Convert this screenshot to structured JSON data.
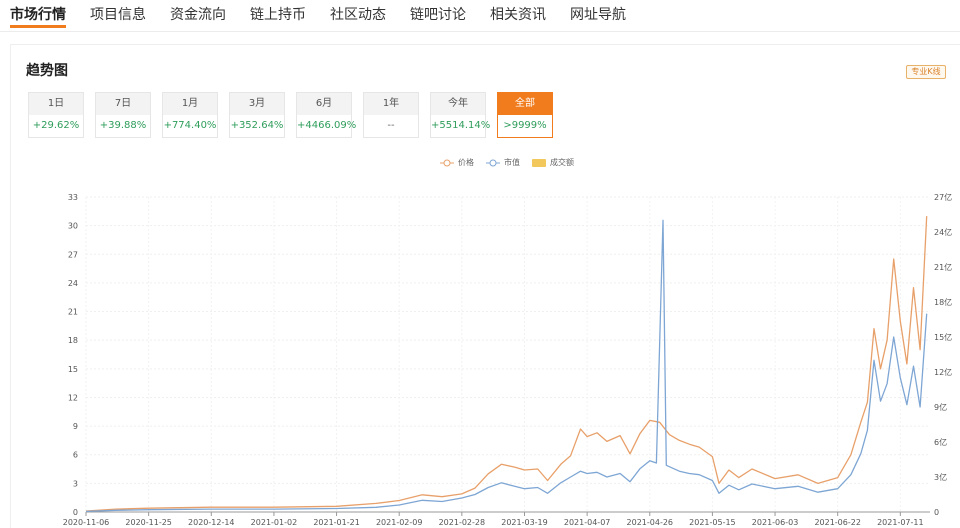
{
  "nav": {
    "items": [
      "市场行情",
      "项目信息",
      "资金流向",
      "链上持币",
      "社区动态",
      "链吧讨论",
      "相关资讯",
      "网址导航"
    ],
    "active_index": 0
  },
  "section": {
    "title": "趋势图",
    "pro_button": "专业K线"
  },
  "periods": [
    {
      "label": "1日",
      "change": "+29.62%"
    },
    {
      "label": "7日",
      "change": "+39.88%"
    },
    {
      "label": "1月",
      "change": "+774.40%"
    },
    {
      "label": "3月",
      "change": "+352.64%"
    },
    {
      "label": "6月",
      "change": "+4466.09%"
    },
    {
      "label": "1年",
      "change": "--"
    },
    {
      "label": "今年",
      "change": "+5514.14%"
    },
    {
      "label": "全部",
      "change": ">9999%",
      "active": true
    }
  ],
  "colors": {
    "accent": "#f07c1e",
    "price": "#e8a06a",
    "market_cap": "#7ea6d4",
    "volume": "#f2c75c",
    "positive": "#2f9d5b"
  },
  "chart_data": {
    "type": "line",
    "legend": [
      {
        "name": "价格",
        "color": "#e8a06a",
        "symbol": "circle"
      },
      {
        "name": "市值",
        "color": "#7ea6d4",
        "symbol": "circle"
      },
      {
        "name": "成交额",
        "color": "#f2c75c",
        "symbol": "rect"
      }
    ],
    "x_ticks": [
      "2020-11-06",
      "2020-11-25",
      "2020-12-14",
      "2021-01-02",
      "2021-01-21",
      "2021-02-09",
      "2021-02-28",
      "2021-03-19",
      "2021-04-07",
      "2021-04-26",
      "2021-05-15",
      "2021-06-03",
      "2021-06-22",
      "2021-07-11"
    ],
    "y_left_ticks": [
      "0",
      "3",
      "6",
      "9",
      "12",
      "15",
      "18",
      "21",
      "24",
      "27",
      "30",
      "33"
    ],
    "y_right_ticks": [
      "0",
      "3亿",
      "6亿",
      "9亿",
      "12亿",
      "15亿",
      "18亿",
      "21亿",
      "24亿",
      "27亿"
    ],
    "y_left_range": [
      0,
      33
    ],
    "y_right_range": [
      0,
      27
    ],
    "x_range": [
      "2020-11-06",
      "2021-07-20"
    ],
    "grid": true,
    "legend_position": "top-center",
    "series": [
      {
        "name": "价格",
        "axis": "left",
        "points": [
          [
            "2020-11-06",
            0.1
          ],
          [
            "2020-11-15",
            0.3
          ],
          [
            "2020-11-25",
            0.4
          ],
          [
            "2020-12-14",
            0.5
          ],
          [
            "2021-01-02",
            0.5
          ],
          [
            "2021-01-21",
            0.6
          ],
          [
            "2021-02-02",
            0.9
          ],
          [
            "2021-02-09",
            1.2
          ],
          [
            "2021-02-16",
            1.8
          ],
          [
            "2021-02-22",
            1.6
          ],
          [
            "2021-02-28",
            1.9
          ],
          [
            "2021-03-04",
            2.5
          ],
          [
            "2021-03-08",
            4.0
          ],
          [
            "2021-03-12",
            5.0
          ],
          [
            "2021-03-16",
            4.7
          ],
          [
            "2021-03-19",
            4.4
          ],
          [
            "2021-03-23",
            4.5
          ],
          [
            "2021-03-26",
            3.3
          ],
          [
            "2021-03-30",
            5.0
          ],
          [
            "2021-04-02",
            5.9
          ],
          [
            "2021-04-05",
            8.7
          ],
          [
            "2021-04-07",
            7.9
          ],
          [
            "2021-04-10",
            8.3
          ],
          [
            "2021-04-13",
            7.4
          ],
          [
            "2021-04-17",
            8.0
          ],
          [
            "2021-04-20",
            6.1
          ],
          [
            "2021-04-23",
            8.2
          ],
          [
            "2021-04-26",
            9.6
          ],
          [
            "2021-04-29",
            9.4
          ],
          [
            "2021-05-02",
            8.1
          ],
          [
            "2021-05-05",
            7.5
          ],
          [
            "2021-05-08",
            7.1
          ],
          [
            "2021-05-11",
            6.8
          ],
          [
            "2021-05-15",
            5.8
          ],
          [
            "2021-05-17",
            3.0
          ],
          [
            "2021-05-20",
            4.4
          ],
          [
            "2021-05-23",
            3.6
          ],
          [
            "2021-05-27",
            4.5
          ],
          [
            "2021-06-03",
            3.5
          ],
          [
            "2021-06-10",
            3.9
          ],
          [
            "2021-06-16",
            3.0
          ],
          [
            "2021-06-22",
            3.6
          ],
          [
            "2021-06-26",
            6.0
          ],
          [
            "2021-06-29",
            9.4
          ],
          [
            "2021-07-01",
            11.5
          ],
          [
            "2021-07-03",
            19.2
          ],
          [
            "2021-07-05",
            15.0
          ],
          [
            "2021-07-07",
            18.0
          ],
          [
            "2021-07-09",
            26.5
          ],
          [
            "2021-07-11",
            20.0
          ],
          [
            "2021-07-13",
            15.5
          ],
          [
            "2021-07-15",
            23.5
          ],
          [
            "2021-07-17",
            17.0
          ],
          [
            "2021-07-19",
            31.0
          ]
        ]
      },
      {
        "name": "市值",
        "axis": "right",
        "points": [
          [
            "2020-11-06",
            0.05
          ],
          [
            "2020-11-15",
            0.15
          ],
          [
            "2020-11-25",
            0.2
          ],
          [
            "2020-12-14",
            0.25
          ],
          [
            "2021-01-02",
            0.25
          ],
          [
            "2021-01-21",
            0.3
          ],
          [
            "2021-02-02",
            0.4
          ],
          [
            "2021-02-09",
            0.6
          ],
          [
            "2021-02-16",
            1.0
          ],
          [
            "2021-02-22",
            0.9
          ],
          [
            "2021-02-28",
            1.2
          ],
          [
            "2021-03-04",
            1.5
          ],
          [
            "2021-03-08",
            2.1
          ],
          [
            "2021-03-12",
            2.5
          ],
          [
            "2021-03-16",
            2.2
          ],
          [
            "2021-03-19",
            2.0
          ],
          [
            "2021-03-23",
            2.1
          ],
          [
            "2021-03-26",
            1.6
          ],
          [
            "2021-03-30",
            2.5
          ],
          [
            "2021-04-02",
            3.0
          ],
          [
            "2021-04-05",
            3.5
          ],
          [
            "2021-04-07",
            3.3
          ],
          [
            "2021-04-10",
            3.4
          ],
          [
            "2021-04-13",
            3.0
          ],
          [
            "2021-04-17",
            3.3
          ],
          [
            "2021-04-20",
            2.6
          ],
          [
            "2021-04-23",
            3.7
          ],
          [
            "2021-04-26",
            4.4
          ],
          [
            "2021-04-28",
            4.2
          ],
          [
            "2021-04-30",
            25.0
          ],
          [
            "2021-05-01",
            4.0
          ],
          [
            "2021-05-05",
            3.5
          ],
          [
            "2021-05-08",
            3.3
          ],
          [
            "2021-05-11",
            3.2
          ],
          [
            "2021-05-15",
            2.7
          ],
          [
            "2021-05-17",
            1.6
          ],
          [
            "2021-05-20",
            2.3
          ],
          [
            "2021-05-23",
            1.9
          ],
          [
            "2021-05-27",
            2.4
          ],
          [
            "2021-06-03",
            2.0
          ],
          [
            "2021-06-10",
            2.2
          ],
          [
            "2021-06-16",
            1.7
          ],
          [
            "2021-06-22",
            2.0
          ],
          [
            "2021-06-26",
            3.2
          ],
          [
            "2021-06-29",
            5.0
          ],
          [
            "2021-07-01",
            7.0
          ],
          [
            "2021-07-03",
            13.0
          ],
          [
            "2021-07-05",
            9.5
          ],
          [
            "2021-07-07",
            11.0
          ],
          [
            "2021-07-09",
            15.0
          ],
          [
            "2021-07-11",
            11.5
          ],
          [
            "2021-07-13",
            9.2
          ],
          [
            "2021-07-15",
            12.5
          ],
          [
            "2021-07-17",
            9.0
          ],
          [
            "2021-07-19",
            17.0
          ]
        ]
      }
    ]
  }
}
